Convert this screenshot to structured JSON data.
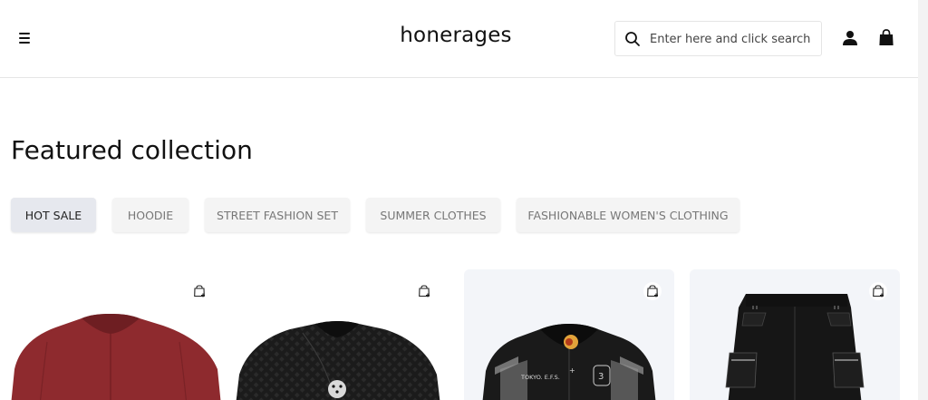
{
  "header": {
    "logo": "honerages",
    "search": {
      "placeholder": "Enter here and click search",
      "value": ""
    },
    "icons": [
      "menu-icon",
      "search-icon",
      "user-icon",
      "shopping-bag-icon"
    ]
  },
  "collection": {
    "title": "Featured collection",
    "tabs": [
      {
        "label": "HOT SALE",
        "active": true
      },
      {
        "label": "HOODIE",
        "active": false
      },
      {
        "label": "STREET FASHION SET",
        "active": false
      },
      {
        "label": "SUMMER CLOTHES",
        "active": false
      },
      {
        "label": "FASHIONABLE WOMEN'S CLOTHING",
        "active": false
      }
    ]
  },
  "products": [
    {
      "image": "red-jacket",
      "background": "#ffffff"
    },
    {
      "image": "black-patterned-jacket",
      "background": "#ffffff"
    },
    {
      "image": "black-varsity-jacket",
      "background": "#f3f5f9",
      "printed_text": [
        "TOKYO. E.F.S.",
        "3"
      ]
    },
    {
      "image": "black-cargo-shorts",
      "background": "#f3f5f9"
    }
  ],
  "colors": {
    "accent": "#111111",
    "tab_active_bg": "#e6e8ee",
    "tab_bg": "#f4f4f4",
    "jacket_red": "#8e2a2e"
  }
}
